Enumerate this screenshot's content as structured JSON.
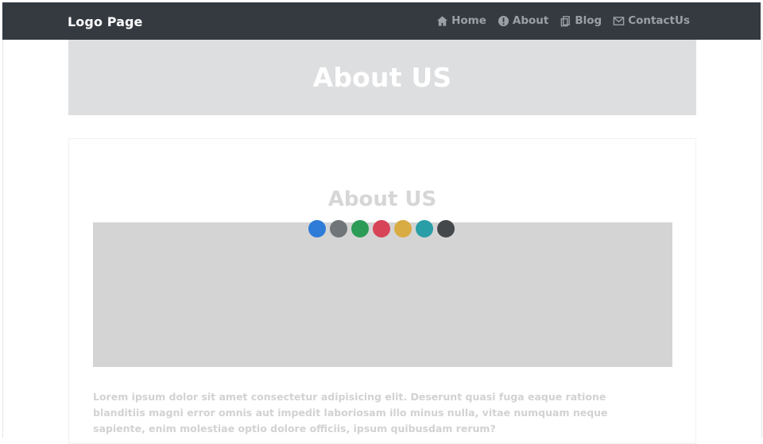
{
  "navbar": {
    "brand": "Logo Page",
    "links": [
      {
        "label": "Home",
        "icon": "home-icon"
      },
      {
        "label": "About",
        "icon": "info-icon"
      },
      {
        "label": "Blog",
        "icon": "copy-icon"
      },
      {
        "label": "ContactUs",
        "icon": "envelope-icon"
      }
    ]
  },
  "hero": {
    "title": "About US"
  },
  "content": {
    "title": "About US",
    "dots": [
      {
        "color": "#2f7bd8"
      },
      {
        "color": "#707579"
      },
      {
        "color": "#2c9b55"
      },
      {
        "color": "#d74458"
      },
      {
        "color": "#d9ab43"
      },
      {
        "color": "#2a9ea7"
      },
      {
        "color": "#45484b"
      }
    ],
    "paragraph": "Lorem ipsum dolor sit amet consectetur adipisicing elit. Deserunt quasi fuga eaque ratione blanditiis magni error omnis aut impedit laboriosam illo minus nulla, vitae numquam neque sapiente, enim molestiae optio dolore officiis, ipsum quibusdam rerum?"
  },
  "colors": {
    "navbar_bg": "#343a40",
    "hero_bg": "#dddee0",
    "image_bg": "#d4d4d4"
  }
}
